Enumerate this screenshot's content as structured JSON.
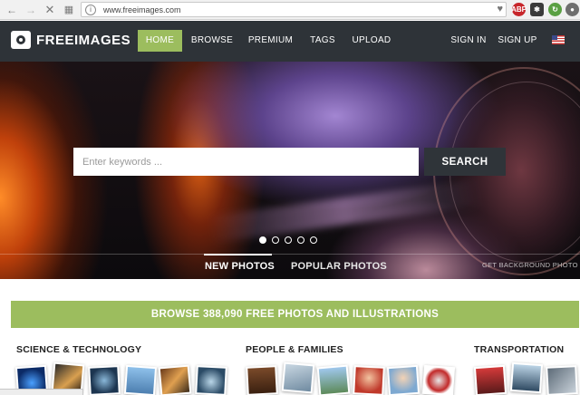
{
  "browser": {
    "url": "www.freeimages.com",
    "back_icon": "back-arrow-icon",
    "forward_icon": "forward-arrow-icon",
    "stop_icon": "close-icon",
    "apps_icon": "apps-grid-icon",
    "extensions": [
      {
        "name": "adblock-icon",
        "label": "ABP",
        "color": "#c7262b"
      },
      {
        "name": "puzzle-extension-icon",
        "label": "",
        "color": "#3b3b3b"
      },
      {
        "name": "update-icon",
        "label": "",
        "color": "#5aa043"
      },
      {
        "name": "profile-icon",
        "label": "",
        "color": "#6f6f6f"
      }
    ]
  },
  "site": {
    "logo_text": "FREEIMAGES",
    "nav": [
      {
        "label": "HOME",
        "active": true
      },
      {
        "label": "BROWSE",
        "active": false
      },
      {
        "label": "PREMIUM",
        "active": false
      },
      {
        "label": "TAGS",
        "active": false
      },
      {
        "label": "UPLOAD",
        "active": false
      }
    ],
    "sign_in": "SIGN IN",
    "sign_up": "SIGN UP",
    "flag_icon": "us-flag-icon",
    "accent_color": "#9cbd5e",
    "header_color": "#2e3338"
  },
  "hero": {
    "search_placeholder": "Enter keywords ...",
    "search_button": "SEARCH",
    "slide_count": 5,
    "active_slide": 1,
    "tabs": [
      {
        "label": "NEW PHOTOS",
        "active": true
      },
      {
        "label": "POPULAR PHOTOS",
        "active": false
      }
    ],
    "get_background": "GET BACKGROUND PHOTO"
  },
  "banner": {
    "text": "BROWSE 388,090 FREE PHOTOS AND ILLUSTRATIONS"
  },
  "categories": [
    {
      "title": "SCIENCE & TECHNOLOGY"
    },
    {
      "title": "PEOPLE & FAMILIES"
    },
    {
      "title": "TRANSPORTATION"
    }
  ]
}
